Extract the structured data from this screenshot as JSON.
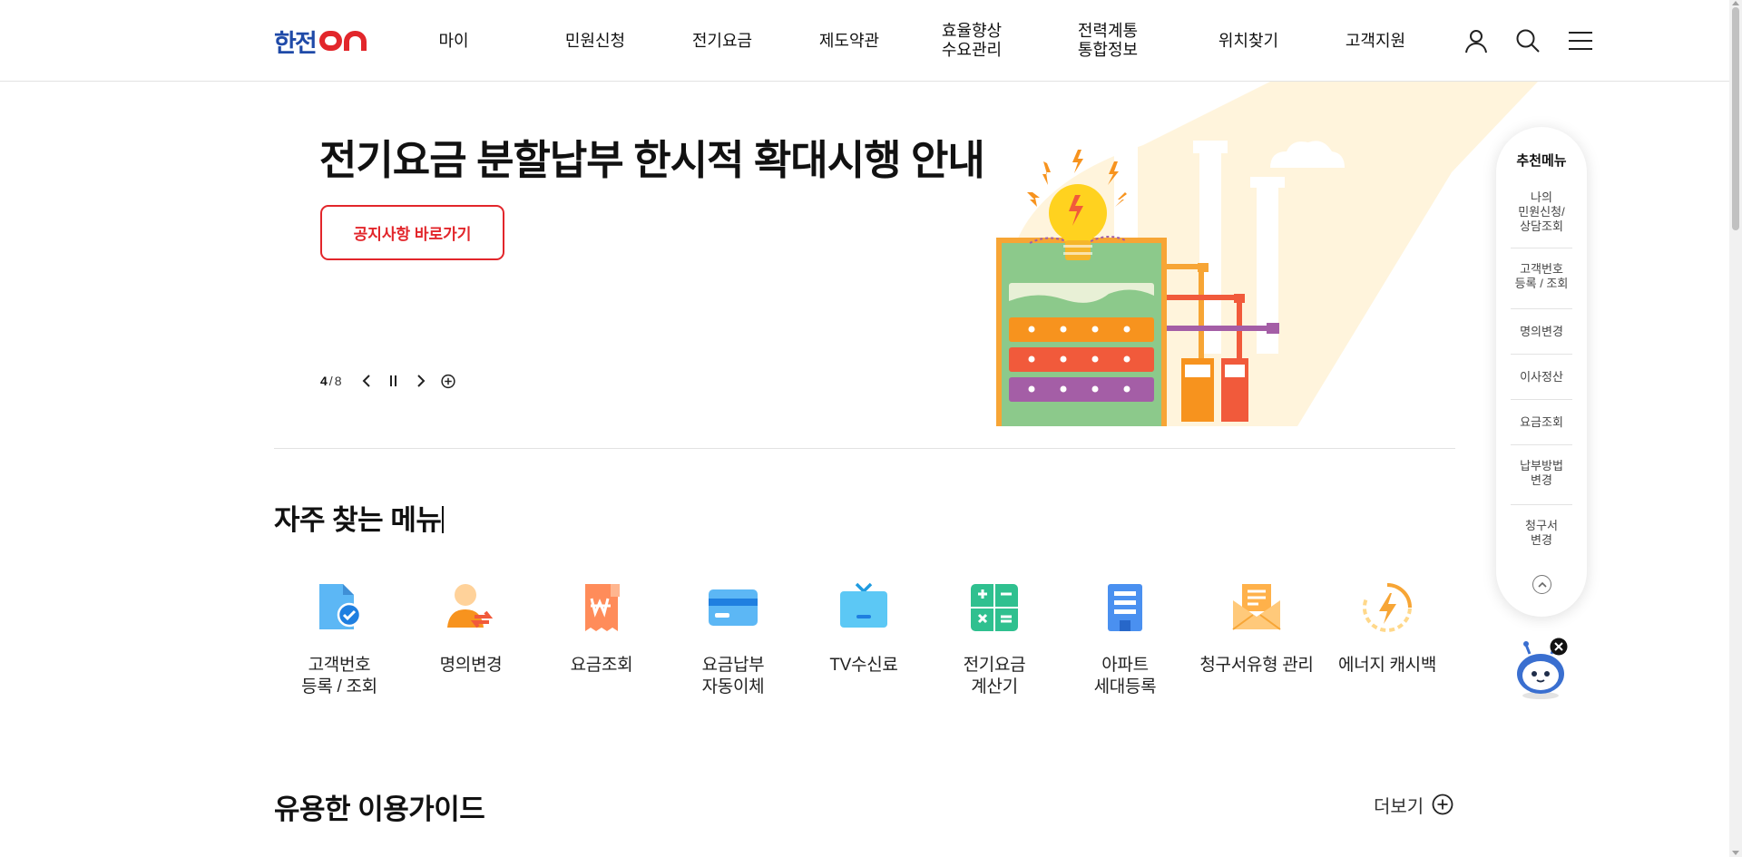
{
  "header": {
    "logo_text": "한전",
    "logo_suffix": "ON",
    "nav": [
      {
        "label": "마이"
      },
      {
        "label": "민원신청"
      },
      {
        "label": "전기요금"
      },
      {
        "label": "제도약관"
      },
      {
        "label": "효율향상\n수요관리"
      },
      {
        "label": "전력계통\n통합정보"
      },
      {
        "label": "위치찾기"
      },
      {
        "label": "고객지원"
      }
    ],
    "icons": [
      "user-icon",
      "search-icon",
      "menu-icon"
    ]
  },
  "hero": {
    "title": "전기요금 분할납부 한시적 확대시행 안내",
    "button_label": "공지사항 바로가기",
    "pager_current": "4",
    "pager_sep": "/",
    "pager_total": "8",
    "controls": [
      "prev-icon",
      "pause-icon",
      "next-icon",
      "plus-circle-icon"
    ],
    "colors": {
      "accent": "#e2262b",
      "bar_orange": "#f7931e",
      "bar_red": "#f15a3b",
      "bar_purple": "#a45ea6",
      "tank_green": "#8cc98b"
    }
  },
  "quick_menu": {
    "title": "추천메뉴",
    "items": [
      {
        "label": "나의\n민원신청/\n상담조회"
      },
      {
        "label": "고객번호\n등록 / 조회"
      },
      {
        "label": "명의변경"
      },
      {
        "label": "이사정산"
      },
      {
        "label": "요금조회"
      },
      {
        "label": "납부방법\n변경"
      },
      {
        "label": "청구서\n변경"
      }
    ],
    "top_icon": "chevron-up-icon"
  },
  "frequent_menu": {
    "title_normal": "자주 찾는 ",
    "title_bold": "메뉴",
    "items": [
      {
        "label": "고객번호\n등록 / 조회",
        "icon": "document-check-icon"
      },
      {
        "label": "명의변경",
        "icon": "person-transfer-icon"
      },
      {
        "label": "요금조회",
        "icon": "receipt-won-icon"
      },
      {
        "label": "요금납부\n자동이체",
        "icon": "credit-card-icon"
      },
      {
        "label": "TV수신료",
        "icon": "tv-icon"
      },
      {
        "label": "전기요금\n계산기",
        "icon": "calculator-icon"
      },
      {
        "label": "아파트\n세대등록",
        "icon": "apartment-icon"
      },
      {
        "label": "청구서유형 관리",
        "icon": "envelope-icon"
      },
      {
        "label": "에너지 캐시백",
        "icon": "energy-cashback-icon"
      }
    ]
  },
  "guide": {
    "title_normal": "유용한 ",
    "title_bold": "이용가이드",
    "more_label": "더보기"
  },
  "chatbot": {
    "icon": "chatbot-robot-icon",
    "close_icon": "close-icon"
  }
}
